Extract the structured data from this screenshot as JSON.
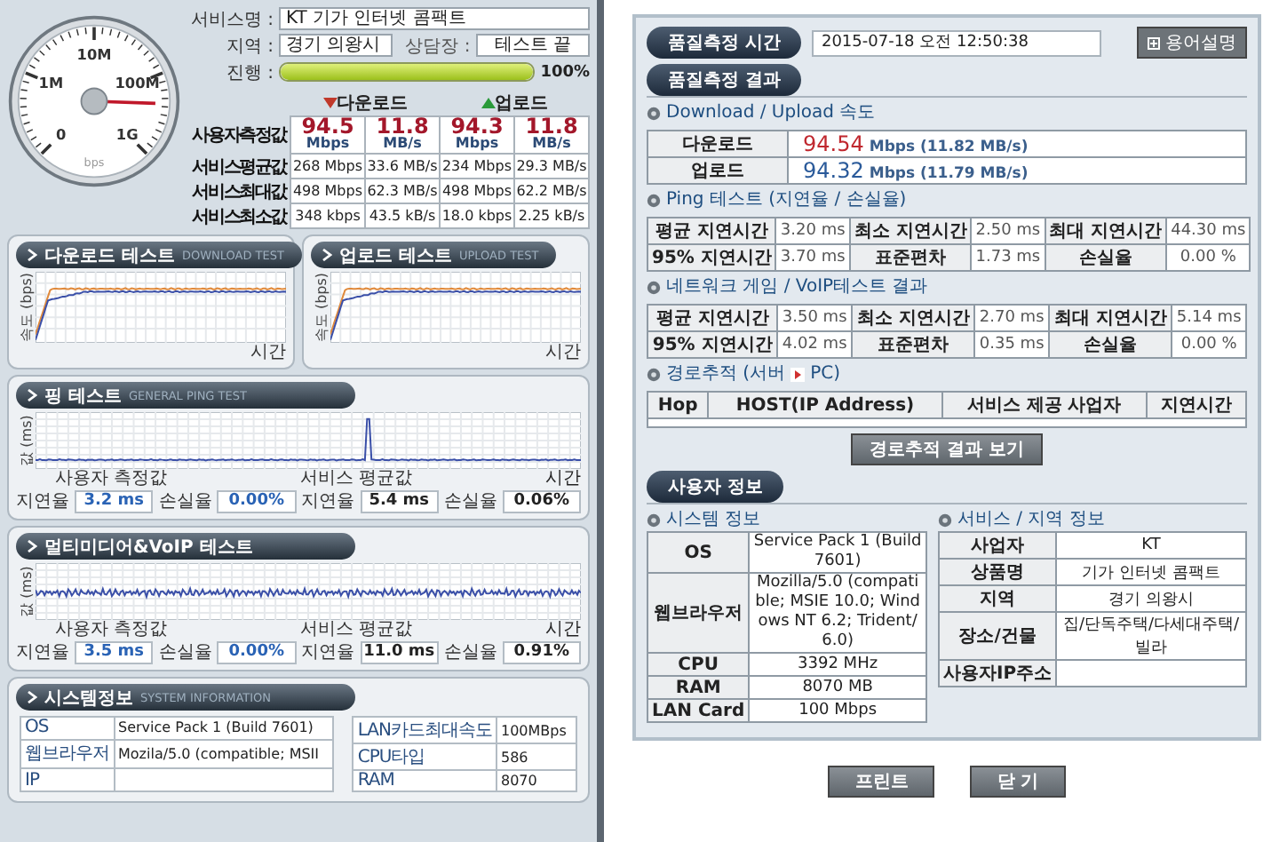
{
  "left": {
    "gauge": {
      "labels": [
        "0",
        "1M",
        "10M",
        "100M",
        "1G"
      ],
      "unit": "bps"
    },
    "service": {
      "label": "서비스명 :",
      "value": "KT 기가 인터넷 콤팩트"
    },
    "region": {
      "label": "지역 :",
      "value": "경기 의왕시"
    },
    "shop": {
      "label": "상담장 :",
      "value": "테스트 끝"
    },
    "progress": {
      "label": "진행 :",
      "level": 1.0,
      "reading": "100%"
    },
    "speed_table": {
      "headers": [
        {
          "label": "다운로드",
          "kind": "down"
        },
        {
          "label": "업로드",
          "kind": "up"
        }
      ],
      "rows": [
        {
          "label": "사용자측정값",
          "kind": "main",
          "cells": [
            {
              "value": "94.5",
              "unit": "Mbps"
            },
            {
              "value": "11.8",
              "unit": "MB/s"
            },
            {
              "value": "94.3",
              "unit": "Mbps"
            },
            {
              "value": "11.8",
              "unit": "MB/s"
            }
          ]
        },
        {
          "label": "서비스평균값",
          "kind": "plain",
          "cells": [
            {
              "value": "268 Mbps"
            },
            {
              "value": "33.6 MB/s"
            },
            {
              "value": "234 Mbps"
            },
            {
              "value": "29.3 MB/s"
            }
          ]
        },
        {
          "label": "서비스최대값",
          "kind": "plain",
          "cells": [
            {
              "value": "498 Mbps"
            },
            {
              "value": "62.3 MB/s"
            },
            {
              "value": "498 Mbps"
            },
            {
              "value": "62.2 MB/s"
            }
          ]
        },
        {
          "label": "서비스최소값",
          "kind": "plain",
          "cells": [
            {
              "value": "348 kbps"
            },
            {
              "value": "43.5 kB/s"
            },
            {
              "value": "18.0 kbps"
            },
            {
              "value": "2.25 kB/s"
            }
          ]
        }
      ]
    },
    "speed_tests": [
      {
        "title": "다운로드 테스트",
        "subtitle": "DOWNLOAD TEST",
        "ylabel": "속도 (bps)",
        "xlabel": "시간",
        "kind": "speed"
      },
      {
        "title": "업로드 테스트",
        "subtitle": "UPLOAD TEST",
        "ylabel": "속도 (bps)",
        "xlabel": "시간",
        "kind": "speed"
      }
    ],
    "latency_tests": [
      {
        "title": "핑 테스트",
        "subtitle": "GENERAL PING TEST",
        "ylabel": "값 (ms)",
        "xlabel": "시간",
        "kind": "ping",
        "groups": [
          {
            "caption": "사용자 측정값",
            "kind": "user",
            "delay_label": "지연율",
            "delay": "3.2 ms",
            "loss_label": "손실율",
            "loss": "0.00%"
          },
          {
            "caption": "서비스 평균값",
            "kind": "service",
            "delay_label": "지연율",
            "delay": "5.4 ms",
            "loss_label": "손실율",
            "loss": "0.06%"
          }
        ]
      },
      {
        "title": "멀티미디어&VoIP 테스트",
        "ylabel": "값 (ms)",
        "xlabel": "시간",
        "kind": "voip",
        "groups": [
          {
            "caption": "사용자 측정값",
            "kind": "user",
            "delay_label": "지연율",
            "delay": "3.5 ms",
            "loss_label": "손실율",
            "loss": "0.00%"
          },
          {
            "caption": "서비스 평균값",
            "kind": "service",
            "delay_label": "지연율",
            "delay": "11.0 ms",
            "loss_label": "손실율",
            "loss": "0.91%"
          }
        ]
      }
    ],
    "system_info": {
      "title": "시스템정보",
      "subtitle": "SYSTEM INFORMATION",
      "left_rows": [
        {
          "label": "OS",
          "value": "Service Pack 1 (Build 7601)"
        },
        {
          "label": "웹브라우저",
          "value": "Mozila/5.0 (compatible; MSII"
        },
        {
          "label": "IP"
        }
      ],
      "right_rows": [
        {
          "label": "LAN카드최대속도",
          "value": "100MBps"
        },
        {
          "label": "CPU타입",
          "value": "586"
        },
        {
          "label": "RAM",
          "value": "8070"
        }
      ]
    }
  },
  "right": {
    "time": {
      "label": "품질측정 시간",
      "value": "2015-07-18 오전 12:50:38"
    },
    "glossary_button": "용어설명",
    "result_title": "품질측정 결과",
    "speed": {
      "title": "Download / Upload 속도",
      "rows": [
        {
          "label": "다운로드",
          "value": "94.54",
          "detail": "Mbps (11.82 MB/s)",
          "kind": "down"
        },
        {
          "label": "업로드",
          "value": "94.32",
          "detail": "Mbps (11.79 MB/s)",
          "kind": "up"
        }
      ]
    },
    "ping": {
      "title": "Ping 테스트 (지연율 / 손실율)",
      "rows": [
        [
          "평균 지연시간",
          "3.20 ms",
          "최소 지연시간",
          "2.50 ms",
          "최대 지연시간",
          "44.30 ms"
        ],
        [
          "95% 지연시간",
          "3.70 ms",
          "표준편차",
          "1.73 ms",
          "손실율",
          "0.00 %"
        ]
      ]
    },
    "voip": {
      "title": "네트워크 게임 / VoIP테스트 결과",
      "rows": [
        [
          "평균 지연시간",
          "3.50 ms",
          "최소 지연시간",
          "2.70 ms",
          "최대 지연시간",
          "5.14 ms"
        ],
        [
          "95% 지연시간",
          "4.02 ms",
          "표준편차",
          "0.35 ms",
          "손실율",
          "0.00 %"
        ]
      ]
    },
    "trace": {
      "title_before": "경로추적 (서버",
      "title_after": "PC)",
      "columns": [
        "Hop",
        "HOST(IP Address)",
        "서비스 제공 사업자",
        "지연시간"
      ],
      "button": "경로추적 결과 보기"
    },
    "user_title": "사용자 정보",
    "system": {
      "title": "시스템 정보",
      "rows": [
        {
          "label": "OS",
          "value": "Service Pack 1 (Build 7601)"
        },
        {
          "label": "웹브라우저",
          "value": "Mozilla/5.0 (compatible; MSIE 10.0; Windows NT 6.2; Trident/6.0)"
        },
        {
          "label": "CPU",
          "value": "3392 MHz"
        },
        {
          "label": "RAM",
          "value": "8070 MB"
        },
        {
          "label": "LAN Card",
          "value": "100 Mbps"
        }
      ]
    },
    "service": {
      "title": "서비스 / 지역 정보",
      "rows": [
        {
          "label": "사업자",
          "value": "KT"
        },
        {
          "label": "상품명",
          "value": "기가 인터넷 콤팩트"
        },
        {
          "label": "지역",
          "value": "경기 의왕시"
        },
        {
          "label": "장소/건물",
          "value": "집/단독주택/다세대주택/빌라"
        },
        {
          "label": "사용자IP주소"
        }
      ]
    },
    "buttons": [
      "프린트",
      "닫 기"
    ]
  }
}
